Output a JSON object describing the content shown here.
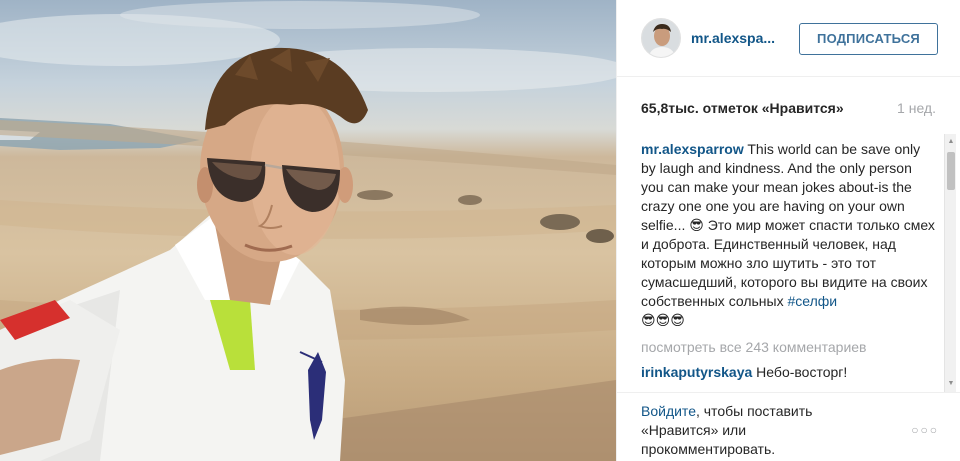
{
  "post": {
    "username": "mr.alexspa...",
    "follow_label": "ПОДПИСАТЬСЯ",
    "likes": "65,8тыс. отметок «Нравится»",
    "time_ago": "1 нед.",
    "caption_user": "mr.alexsparrow",
    "caption_text": " This world can be save only by laugh and kindness. And the only person you can make your mean jokes about-is the crazy one one you are having on your own selfie... 😎 Это мир может спасти только смех и доброта. Единственный человек, над которым можно зло шутить - это тот сумасшедший, которого вы видите на своих собственных сольных ",
    "caption_hashtag": "#селфи",
    "caption_emoji": "😎😎😎",
    "view_all_comments": "посмотреть все 243 комментариев",
    "comments": [
      {
        "user": "irinkaputyrskaya",
        "text": " Небо-восторг!"
      }
    ],
    "login_link": "Войдите",
    "login_text": ", чтобы поставить «Нравится» или прокомментировать.",
    "more_icon": "more-dots-icon"
  },
  "colors": {
    "link_blue": "#125688",
    "follow_border": "#3f729b",
    "muted": "#a5a7aa"
  }
}
